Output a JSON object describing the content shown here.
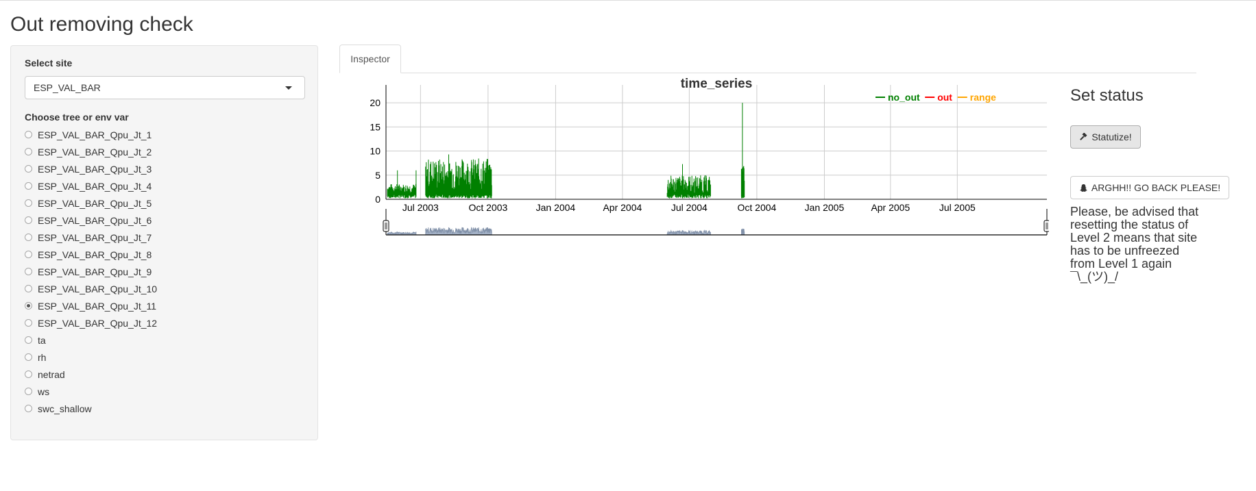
{
  "page": {
    "title": "Out removing check"
  },
  "sidebar": {
    "site_label": "Select site",
    "site_value": "ESP_VAL_BAR",
    "var_label": "Choose tree or env var",
    "options": [
      "ESP_VAL_BAR_Qpu_Jt_1",
      "ESP_VAL_BAR_Qpu_Jt_2",
      "ESP_VAL_BAR_Qpu_Jt_3",
      "ESP_VAL_BAR_Qpu_Jt_4",
      "ESP_VAL_BAR_Qpu_Jt_5",
      "ESP_VAL_BAR_Qpu_Jt_6",
      "ESP_VAL_BAR_Qpu_Jt_7",
      "ESP_VAL_BAR_Qpu_Jt_8",
      "ESP_VAL_BAR_Qpu_Jt_9",
      "ESP_VAL_BAR_Qpu_Jt_10",
      "ESP_VAL_BAR_Qpu_Jt_11",
      "ESP_VAL_BAR_Qpu_Jt_12",
      "ta",
      "rh",
      "netrad",
      "ws",
      "swc_shallow"
    ],
    "selected_index": 10
  },
  "tabs": {
    "inspector": "Inspector"
  },
  "status": {
    "title": "Set status",
    "statutize_label": "Statutize!",
    "goback_label": "ARGHH!! GO BACK PLEASE!",
    "warning": "Please, be advised that resetting the status of Level 2 means that site has to be unfreezed from Level 1 again ¯\\_(ツ)_/"
  },
  "chart_data": {
    "type": "line",
    "title": "time_series",
    "x_start": "2003-05-15",
    "x_end": "2005-10-31",
    "ylim": [
      0,
      22
    ],
    "yticks": [
      0,
      5,
      10,
      15,
      20
    ],
    "xticks": [
      "Jul 2003",
      "Oct 2003",
      "Jan 2004",
      "Apr 2004",
      "Jul 2004",
      "Oct 2004",
      "Jan 2005",
      "Apr 2005",
      "Jul 2005"
    ],
    "xtick_dates": [
      "2003-07-01",
      "2003-10-01",
      "2004-01-01",
      "2004-04-01",
      "2004-07-01",
      "2004-10-01",
      "2005-01-01",
      "2005-04-01",
      "2005-07-01"
    ],
    "grid": true,
    "legend_position": "top-right",
    "series": [
      {
        "name": "no_out",
        "color": "#008000"
      },
      {
        "name": "out",
        "color": "#ff0000"
      },
      {
        "name": "range",
        "color": "#ffa500"
      }
    ],
    "segments": [
      {
        "series": "no_out",
        "start": "2003-05-17",
        "end": "2003-06-25",
        "min": 1.2,
        "max": 3.2,
        "peak": 6.0
      },
      {
        "series": "no_out",
        "start": "2003-07-08",
        "end": "2003-10-06",
        "min": 1.5,
        "max": 8.5,
        "peak": 9.3
      },
      {
        "series": "no_out",
        "start": "2004-06-01",
        "end": "2004-07-30",
        "min": 0.8,
        "max": 5.0,
        "peak": 7.3
      },
      {
        "series": "no_out",
        "start": "2004-09-10",
        "end": "2004-09-14",
        "min": 0.5,
        "max": 7.0,
        "peak": 20.0
      }
    ],
    "range_selector": {
      "visible": true
    }
  }
}
